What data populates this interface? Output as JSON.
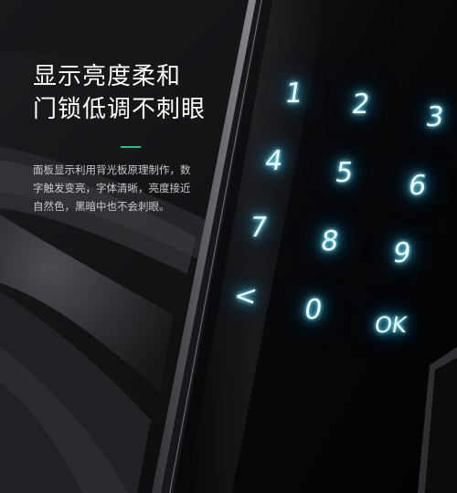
{
  "headline": {
    "line1": "显示亮度柔和",
    "line2": "门锁低调不刺眼"
  },
  "body_text": "面板显示利用背光板原理制作，数字触发变亮，字体清晰，亮度接近自然色，黑暗中也不会刺眼。",
  "keypad": {
    "k1": "1",
    "k2": "2",
    "k3": "3",
    "k4": "4",
    "k5": "5",
    "k6": "6",
    "k7": "7",
    "k8": "8",
    "k9": "9",
    "back": "<",
    "k0": "0",
    "ok": "OK"
  },
  "colors": {
    "accent": "#1ec28b",
    "key_glow": "#46d9ff",
    "panel": "#050607",
    "frame": "#6b6e73"
  }
}
